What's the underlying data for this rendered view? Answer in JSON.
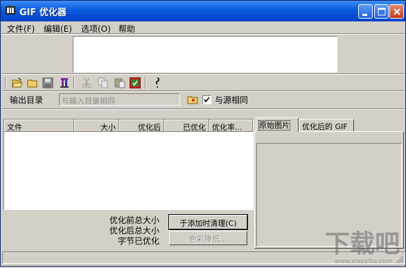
{
  "window": {
    "title": "GIF 优化器",
    "minimize_icon": "minimize-icon",
    "maximize_icon": "maximize-icon",
    "close_icon": "close-icon"
  },
  "menu": [
    {
      "label": "文件(F)"
    },
    {
      "label": "编辑(E)"
    },
    {
      "label": "选项(O)"
    },
    {
      "label": "帮助"
    }
  ],
  "toolbar": {
    "icons": [
      "open-icon",
      "folder-icon",
      "save-icon",
      "delete-icon",
      "cut-icon",
      "copy-icon",
      "paste-icon",
      "optimize-icon",
      "help-icon"
    ]
  },
  "output": {
    "label": "输出目录",
    "placeholder": "与输入目录相同",
    "same_as_source_label": "与源相同",
    "same_as_source_checked": true
  },
  "file_list": {
    "columns": [
      "文件",
      "大小",
      "优化后",
      "已优化",
      "优化率..."
    ],
    "rows": []
  },
  "tabs": [
    {
      "label": "原始图片",
      "active": true
    },
    {
      "label": "优化后的 GIF",
      "active": false
    }
  ],
  "summary": {
    "before_label": "优化前总大小",
    "after_label": "优化后总大小",
    "saved_label": "字节已优化"
  },
  "buttons": {
    "clear_on_add": "于添加时清理(C)",
    "reduce_colors": "色彩降低..."
  },
  "watermark": {
    "text": "下载吧",
    "url": "www.xiazaiba.com"
  },
  "colors": {
    "face": "#d4d0c8",
    "title_blue": "#0a5ae0",
    "close_red": "#c8361b"
  }
}
